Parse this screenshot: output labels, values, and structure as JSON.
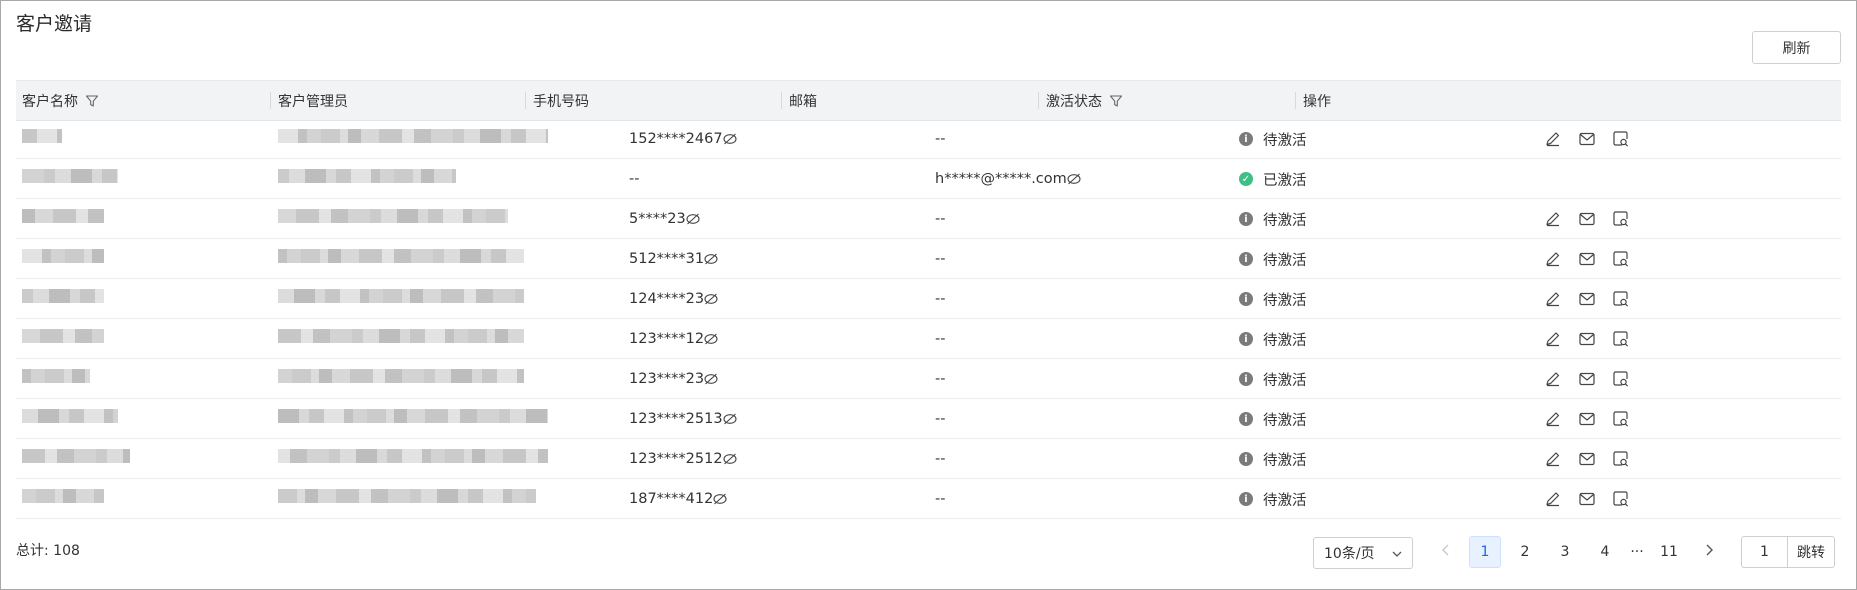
{
  "page": {
    "title": "客户邀请",
    "refresh_label": "刷新"
  },
  "table": {
    "columns": [
      {
        "label": "客户名称",
        "filter": true
      },
      {
        "label": "客户管理员",
        "filter": false
      },
      {
        "label": "手机号码",
        "filter": false
      },
      {
        "label": "邮箱",
        "filter": false
      },
      {
        "label": "激活状态",
        "filter": true
      },
      {
        "label": "操作",
        "filter": false
      }
    ],
    "rows": [
      {
        "phone": "152****2467",
        "email": "--",
        "status": "待激活",
        "status_type": "pending",
        "actions": true
      },
      {
        "phone": "--",
        "email": "h*****@*****.com",
        "status": "已激活",
        "status_type": "active",
        "actions": false
      },
      {
        "phone": "5****23",
        "email": "--",
        "status": "待激活",
        "status_type": "pending",
        "actions": true
      },
      {
        "phone": "512****31",
        "email": "--",
        "status": "待激活",
        "status_type": "pending",
        "actions": true
      },
      {
        "phone": "124****23",
        "email": "--",
        "status": "待激活",
        "status_type": "pending",
        "actions": true
      },
      {
        "phone": "123****12",
        "email": "--",
        "status": "待激活",
        "status_type": "pending",
        "actions": true
      },
      {
        "phone": "123****23",
        "email": "--",
        "status": "待激活",
        "status_type": "pending",
        "actions": true
      },
      {
        "phone": "123****2513",
        "email": "--",
        "status": "待激活",
        "status_type": "pending",
        "actions": true
      },
      {
        "phone": "123****2512",
        "email": "--",
        "status": "待激活",
        "status_type": "pending",
        "actions": true
      },
      {
        "phone": "187****412",
        "email": "--",
        "status": "待激活",
        "status_type": "pending",
        "actions": true
      }
    ],
    "row_icons": [
      "edit-icon",
      "mail-icon",
      "view-detail-icon"
    ],
    "masked_icon": "eye-slash-icon"
  },
  "footer": {
    "total_label": "总计: 108",
    "page_size": "10条/页",
    "pages": [
      "1",
      "2",
      "3",
      "4"
    ],
    "ellipsis": "···",
    "last_page": "11",
    "current_page": "1",
    "jump_value": "1",
    "jump_label": "跳转"
  },
  "colors": {
    "accent": "#1966e6",
    "active_status": "#3fbf85",
    "pending_status": "#7b7b7b",
    "header_bg": "#f2f3f5"
  }
}
